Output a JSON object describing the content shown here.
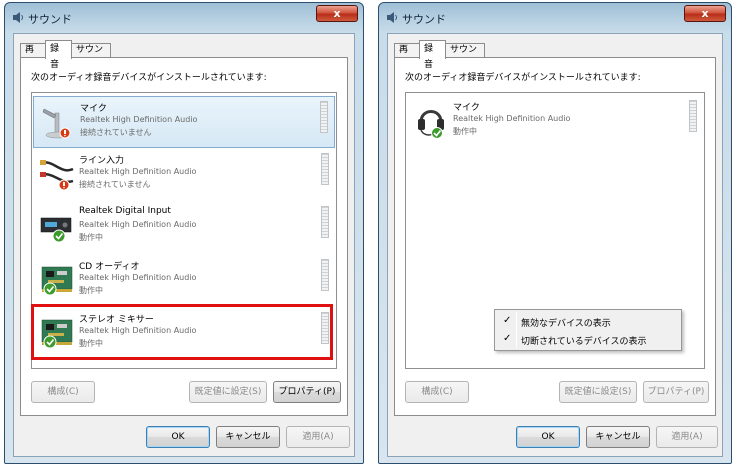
{
  "dialog_title": "サウンド",
  "close_label": "x",
  "tabs": [
    "再生",
    "録音",
    "サウンド"
  ],
  "instruction": "次のオーディオ録音デバイスがインストールされています:",
  "left": {
    "devices": [
      {
        "name": "マイク",
        "driver": "Realtek High Definition Audio",
        "status": "接続されていません",
        "icon": "microphone-icon"
      },
      {
        "name": "ライン入力",
        "driver": "Realtek High Definition Audio",
        "status": "接続されていません",
        "icon": "line-in-cable-icon"
      },
      {
        "name": "Realtek Digital Input",
        "driver": "Realtek High Definition Audio",
        "status": "動作中",
        "icon": "digital-input-device-icon"
      },
      {
        "name": "CD オーディオ",
        "driver": "Realtek High Definition Audio",
        "status": "動作中",
        "icon": "sound-card-icon"
      },
      {
        "name": "ステレオ ミキサー",
        "driver": "Realtek High Definition Audio",
        "status": "動作中",
        "icon": "sound-card-icon"
      }
    ],
    "highlighted_device": "ステレオ ミキサー"
  },
  "right": {
    "devices": [
      {
        "name": "マイク",
        "driver": "Realtek High Definition Audio",
        "status": "動作中",
        "icon": "headset-icon"
      }
    ],
    "context_menu": [
      {
        "label": "無効なデバイスの表示",
        "checked": true
      },
      {
        "label": "切断されているデバイスの表示",
        "checked": true
      }
    ]
  },
  "buttons": {
    "configure": "構成(C)",
    "set_default": "既定値に設定(S)",
    "properties": "プロパティ(P)",
    "ok": "OK",
    "cancel": "キャンセル",
    "apply": "適用(A)"
  },
  "check_glyph": "✓",
  "colors": {
    "highlight_border": "#e01010",
    "selection": "#d5e8f5",
    "close_button": "#c8452c"
  }
}
